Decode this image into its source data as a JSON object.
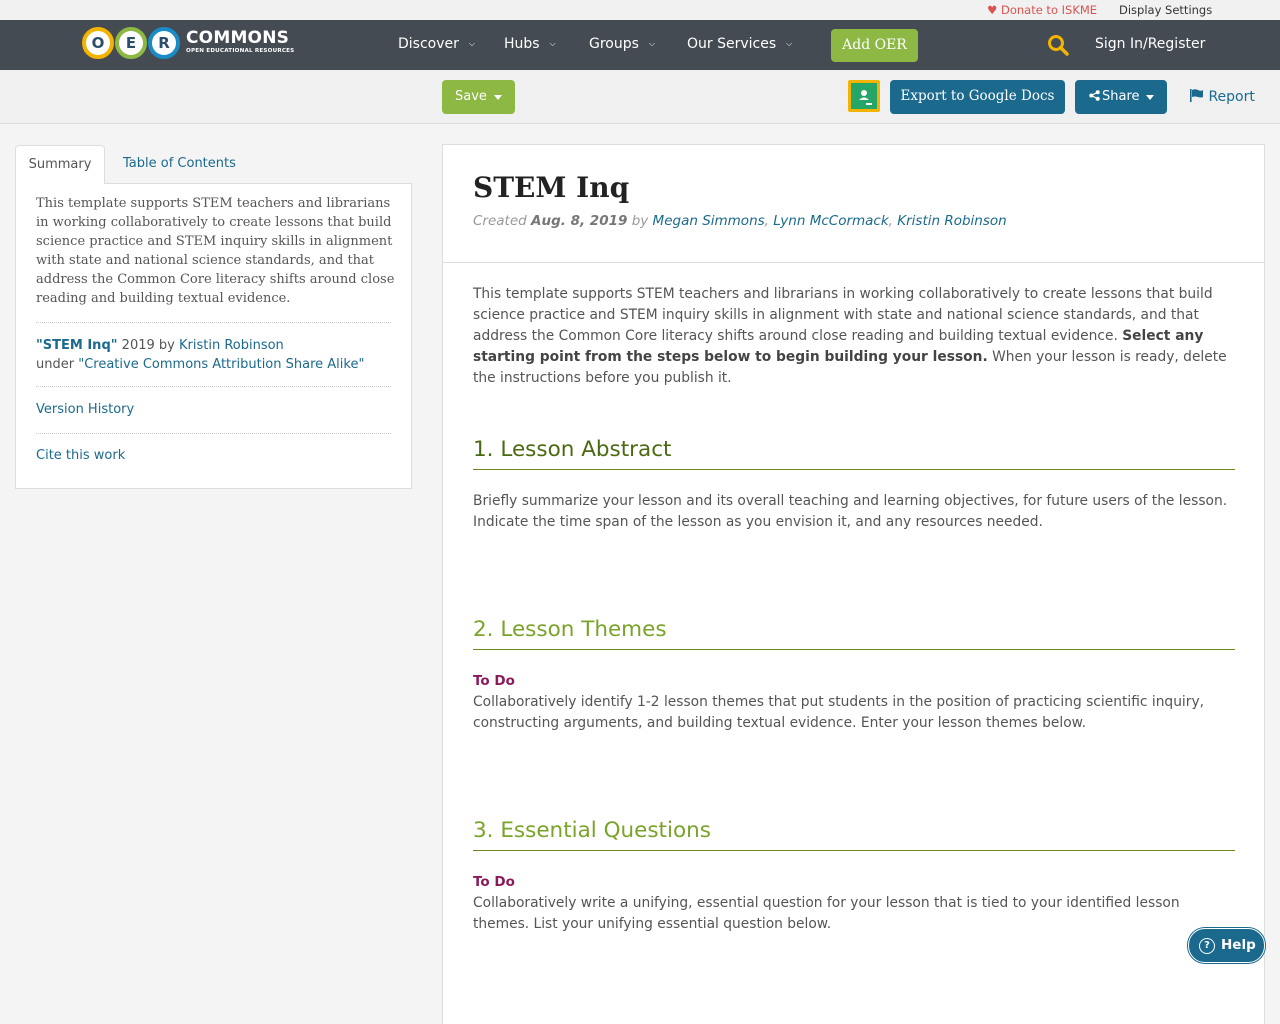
{
  "utility": {
    "donate": "Donate to ISKME",
    "display_settings": "Display Settings"
  },
  "brand": {
    "letters": [
      "O",
      "E",
      "R"
    ],
    "name": "COMMONS",
    "tagline": "OPEN EDUCATIONAL RESOURCES",
    "letter_colors": [
      "#f2b400",
      "#8cb843",
      "#1b8bc6"
    ]
  },
  "nav": {
    "items": [
      "Discover",
      "Hubs",
      "Groups",
      "Our Services"
    ],
    "add_oer": "Add OER",
    "sign_in": "Sign In/Register"
  },
  "toolbar": {
    "save": "Save",
    "export": "Export to Google Docs",
    "share": "Share",
    "report": "Report"
  },
  "sidebar": {
    "tabs": [
      "Summary",
      "Table of Contents"
    ],
    "description": "This template supports STEM teachers and librarians in working collaboratively to create lessons that build science practice and STEM inquiry skills in alignment with state and national science standards, and that address the Common Core literacy shifts around close reading and building textual evidence.",
    "attribution": {
      "title": "\"STEM Inq\"",
      "year_by": "2019 by",
      "author": "Kristin Robinson",
      "under": "under",
      "license": "\"Creative Commons Attribution Share Alike\""
    },
    "version_history": "Version History",
    "cite": "Cite this work"
  },
  "resource": {
    "title": "STEM Inq",
    "created_label": "Created",
    "created_date": "Aug. 8, 2019",
    "by": "by",
    "authors": [
      "Megan Simmons",
      "Lynn McCormack",
      "Kristin Robinson"
    ],
    "intro_1": "This template supports STEM teachers and librarians in working collaboratively to create  lessons that build science practice and STEM inquiry skills in alignment with state and national science standards, and that address the Common Core literacy shifts around close reading and building textual evidence. ",
    "intro_bold": "Select any starting point from the steps below to begin building your lesson.",
    "intro_2": " When your lesson is ready, delete the instructions before you publish it.",
    "sections": [
      {
        "heading": "1. Lesson Abstract",
        "color": "#4a6a12",
        "todo": "",
        "text": "Briefly summarize your lesson and its overall teaching and learning objectives, for future users of the lesson. Indicate the time span of the lesson as you envision it, and any resources needed."
      },
      {
        "heading": "2. Lesson Themes",
        "color": "#7aa32a",
        "todo": "To Do",
        "text": "Collaboratively identify 1-2 lesson themes that put students in the position of practicing scientific inquiry, constructing arguments, and building textual evidence. Enter your lesson themes below."
      },
      {
        "heading": "3. Essential Questions",
        "color": "#7aa32a",
        "todo": "To Do",
        "text": "Collaboratively write a unifying, essential question for your lesson that is tied to your identified lesson themes. List your unifying essential question below."
      }
    ]
  },
  "help": "Help",
  "colors": {
    "nav_bg": "#444b53",
    "green": "#8cb843",
    "blue": "#1b6a8e",
    "todo": "#8b1a5b"
  }
}
